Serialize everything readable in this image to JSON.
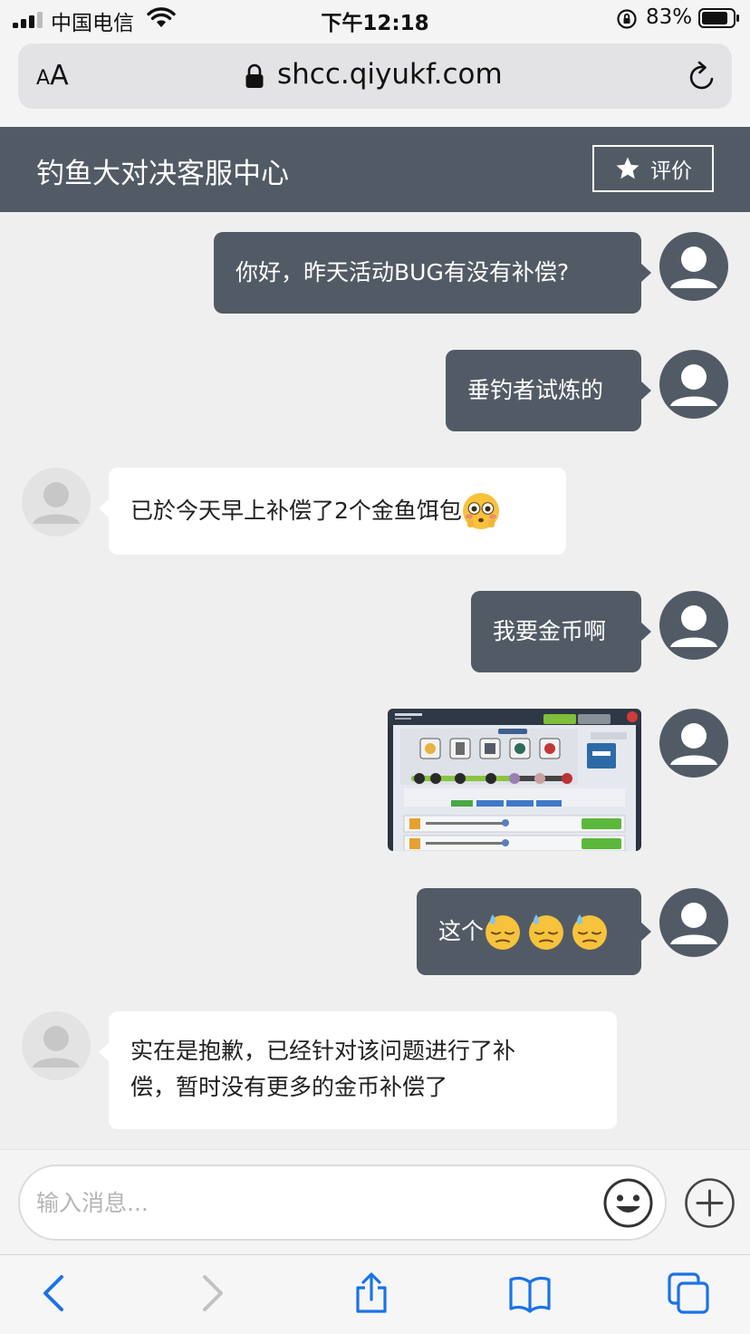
{
  "status_bar": {
    "carrier": "中国电信",
    "time": "下午12:18",
    "battery": "83%"
  },
  "browser": {
    "aa_small": "A",
    "aa_large": "A",
    "url": "shcc.qiyukf.com"
  },
  "header": {
    "title": "钓鱼大对决客服中心",
    "rate_label": "评价"
  },
  "messages": [
    {
      "from": "user",
      "text": "你好，昨天活动BUG有没有补偿?"
    },
    {
      "from": "user",
      "text": "垂钓者试炼的"
    },
    {
      "from": "agent",
      "text": "已於今天早上补偿了2个金鱼饵包",
      "emoji": "flushed-face"
    },
    {
      "from": "user",
      "text": "我要金币啊"
    },
    {
      "from": "user",
      "type": "image",
      "image": "game-screenshot"
    },
    {
      "from": "user",
      "text": "这个",
      "emoji": [
        "downcast-sweat-face",
        "downcast-sweat-face",
        "downcast-sweat-face"
      ]
    },
    {
      "from": "agent",
      "lines": [
        "实在是抱歉，已经针对该问题进行了补",
        "偿，暂时没有更多的金币补偿了"
      ]
    }
  ],
  "composer": {
    "placeholder": "输入消息..."
  },
  "colors": {
    "header_bg": "#525b65",
    "user_bubble": "#525b65",
    "agent_bubble": "#ffffff",
    "chat_bg": "#efefef",
    "ios_blue": "#1a73e8"
  },
  "icons": {
    "status": [
      "signal-icon",
      "wifi-icon",
      "orientation-lock-icon",
      "battery-icon"
    ],
    "browser": [
      "text-size-icon",
      "padlock-icon",
      "reload-icon"
    ],
    "toolbar": [
      "back-icon",
      "forward-icon",
      "share-icon",
      "bookmarks-icon",
      "tabs-icon"
    ]
  }
}
